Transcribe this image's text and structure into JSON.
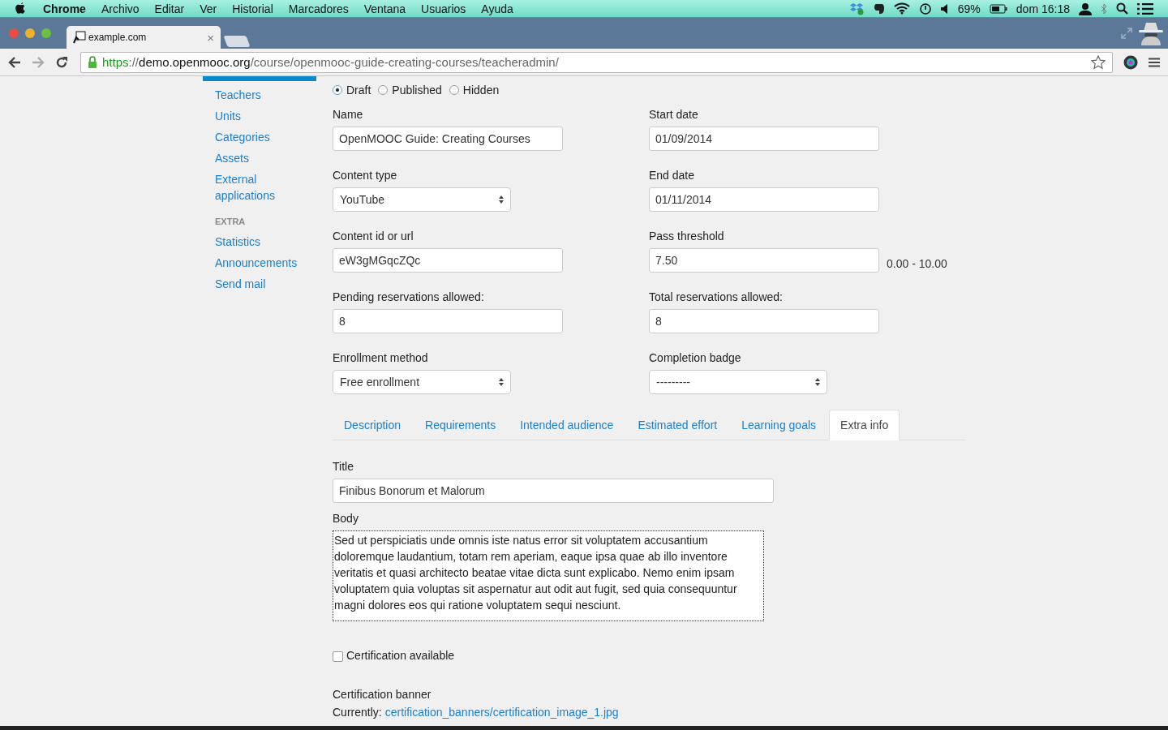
{
  "menubar": {
    "app": "Chrome",
    "items": [
      "Archivo",
      "Editar",
      "Ver",
      "Historial",
      "Marcadores",
      "Ventana",
      "Usuarios",
      "Ayuda"
    ],
    "battery": "69%",
    "clock": "dom 16:18"
  },
  "browser": {
    "tab_title": "example.com",
    "tab_close": "×",
    "url": {
      "scheme": "https",
      "separator": "://",
      "host": "demo.openmooc.org",
      "path": "/course/openmooc-guide-creating-courses/teacheradmin/"
    }
  },
  "sidebar": {
    "items": [
      {
        "label": "Teachers"
      },
      {
        "label": "Units"
      },
      {
        "label": "Categories"
      },
      {
        "label": "Assets"
      },
      {
        "label": "External applications"
      }
    ],
    "section": "EXTRA",
    "extra_items": [
      {
        "label": "Statistics"
      },
      {
        "label": "Announcements"
      },
      {
        "label": "Send mail"
      }
    ]
  },
  "status": [
    {
      "label": "Draft",
      "selected": true
    },
    {
      "label": "Published",
      "selected": false
    },
    {
      "label": "Hidden",
      "selected": false
    }
  ],
  "rows": [
    {
      "left": {
        "label": "Name",
        "kind": "input",
        "value": "OpenMOOC Guide: Creating Courses"
      },
      "right": {
        "label": "Start date",
        "kind": "input",
        "value": "01/09/2014"
      }
    },
    {
      "left": {
        "label": "Content type",
        "kind": "select",
        "value": "YouTube"
      },
      "right": {
        "label": "End date",
        "kind": "input",
        "value": "01/11/2014"
      }
    },
    {
      "left": {
        "label": "Content id or url",
        "kind": "input",
        "value": "eW3gMGqcZQc"
      },
      "right": {
        "label": "Pass threshold",
        "kind": "input",
        "value": "7.50",
        "hint": "0.00 - 10.00"
      }
    },
    {
      "left": {
        "label": "Pending reservations allowed:",
        "kind": "input",
        "value": "8"
      },
      "right": {
        "label": "Total reservations allowed:",
        "kind": "input",
        "value": "8"
      }
    },
    {
      "left": {
        "label": "Enrollment method",
        "kind": "select",
        "value": "Free enrollment"
      },
      "right": {
        "label": "Completion badge",
        "kind": "select",
        "value": "---------"
      }
    }
  ],
  "tabs": [
    {
      "label": "Description",
      "selected": false
    },
    {
      "label": "Requirements",
      "selected": false
    },
    {
      "label": "Intended audience",
      "selected": false
    },
    {
      "label": "Estimated effort",
      "selected": false
    },
    {
      "label": "Learning goals",
      "selected": false
    },
    {
      "label": "Extra info",
      "selected": true
    }
  ],
  "extra": {
    "title_label": "Title",
    "title_value": "Finibus Bonorum et Malorum",
    "body_label": "Body",
    "body_value": "Sed ut perspiciatis unde omnis iste natus error sit voluptatem accusantium doloremque laudantium, totam rem aperiam, eaque ipsa quae ab illo inventore veritatis et quasi architecto beatae vitae dicta sunt explicabo. Nemo enim ipsam voluptatem quia voluptas sit aspernatur aut odit aut fugit, sed quia consequuntur magni dolores eos qui ratione voluptatem sequi nesciunt.",
    "certification": {
      "label": "Certification available",
      "checked": false
    },
    "banner_label": "Certification banner",
    "currently": "Currently:",
    "banner_link": "certification_banners/certification_image_1.jpg"
  }
}
